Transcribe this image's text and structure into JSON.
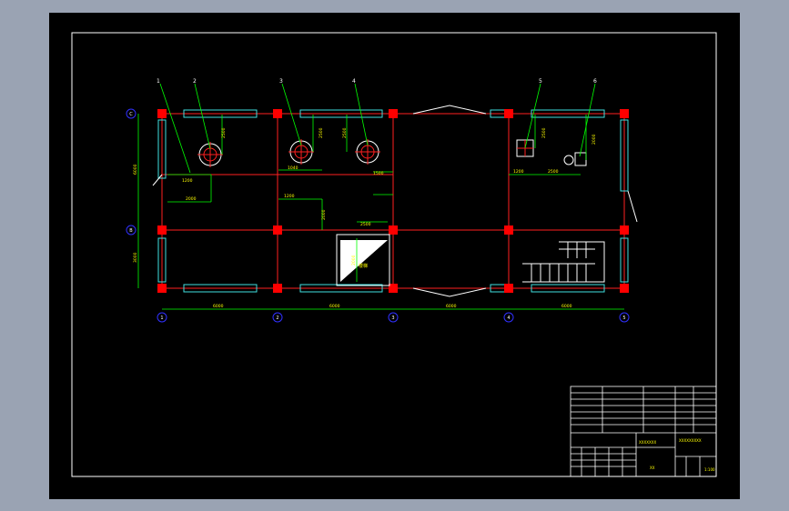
{
  "grid_rows": [
    "C",
    "B"
  ],
  "grid_cols": [
    "1",
    "2",
    "3",
    "4",
    "5"
  ],
  "dimensions": {
    "spans": [
      "6000",
      "6000",
      "6000",
      "6000"
    ],
    "left": [
      "6000",
      "3000"
    ],
    "eq_dims": [
      "2500",
      "2500",
      "2500",
      "2500",
      "2000"
    ],
    "misc": [
      "1200",
      "2000",
      "1040",
      "1500",
      "1200",
      "2000",
      "1200",
      "2500",
      "2500",
      "2000"
    ]
  },
  "callouts": [
    "1",
    "2",
    "3",
    "4",
    "5",
    "6"
  ],
  "stair_label": "楼梯",
  "colors": {
    "background": "#000000",
    "grid_red": "#ff2020",
    "wall_cyan": "#40e0e0",
    "dim_green": "#00ff00",
    "text_yellow": "#ffff00",
    "white": "#ffffff",
    "col_fill": "#ff0000",
    "circle_blue": "#3030ff"
  },
  "title_block": {
    "project": "XXXXXXX",
    "drawing_title": "XXXXXXXXX",
    "scale": "1:100",
    "sheet": "XX"
  }
}
